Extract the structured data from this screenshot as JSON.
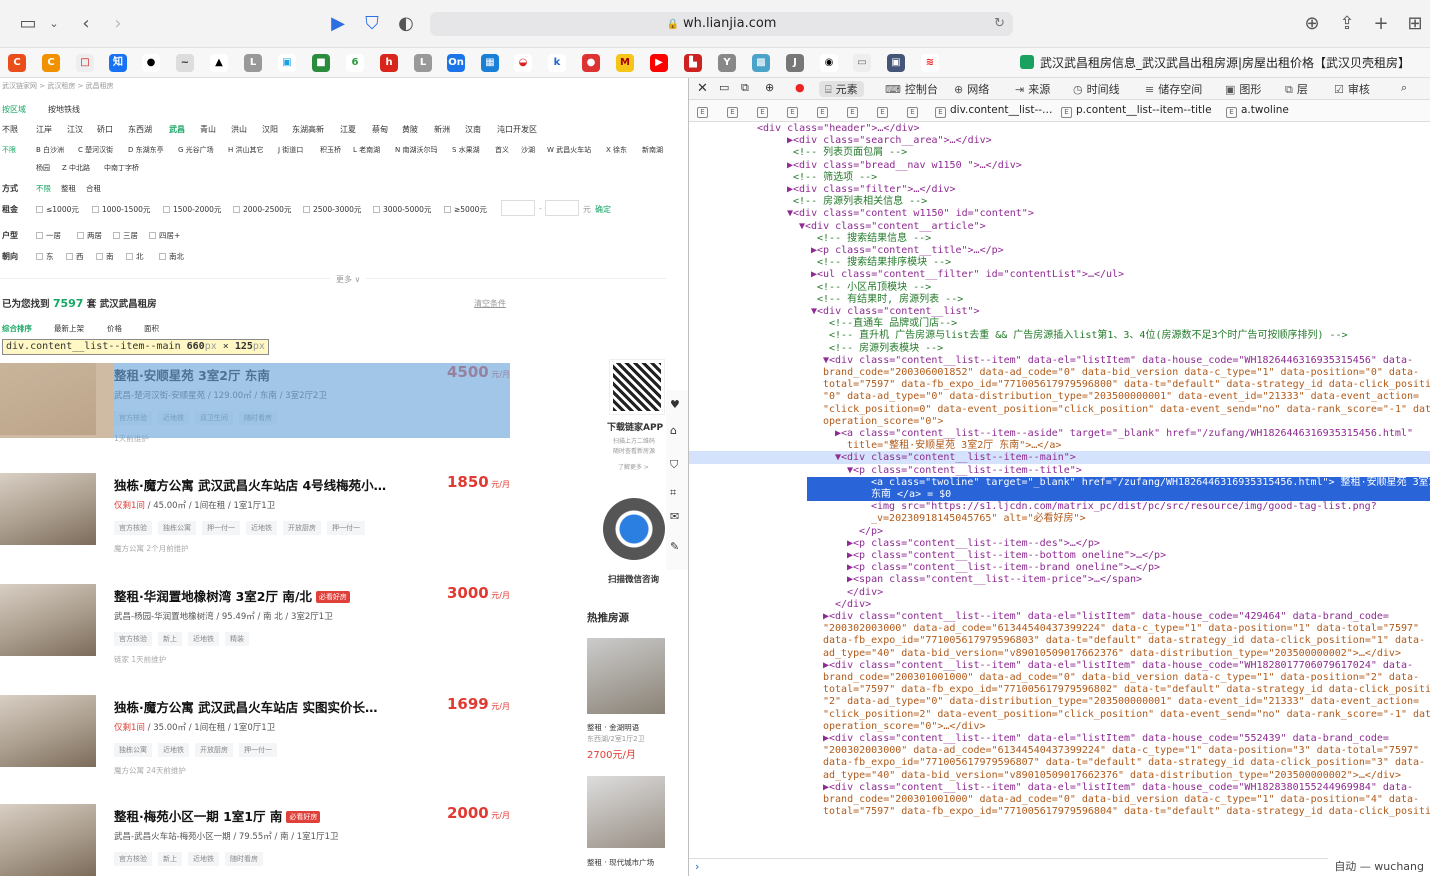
{
  "browser": {
    "url": "wh.lianjia.com"
  },
  "tab_title": "武汉武昌租房信息_武汉武昌出租房源|房屋出租价格【武汉贝壳租房】",
  "breadcrumb": "武汉链家网 > 武汉租房 > 武昌租房",
  "nav": {
    "area_label": "按区域",
    "metro_label": "按地铁线"
  },
  "districts": [
    "不限",
    "江岸",
    "江汉",
    "硚口",
    "东西湖",
    "武昌",
    "青山",
    "洪山",
    "汉阳",
    "东湖高新",
    "江夏",
    "蔡甸",
    "黄陂",
    "新洲",
    "汉南",
    "沌口开发区"
  ],
  "subareas1": [
    "不限",
    "B 白沙洲",
    "C 楚河汉街",
    "D 东湖东亭",
    "G 光谷广场",
    "H 洪山其它",
    "J 街道口",
    "积玉桥",
    "L 老南湖",
    "N 南湖沃尔玛",
    "S 水果湖",
    "首义",
    "沙湖",
    "W 武昌火车站",
    "X 徐东",
    "新南湖"
  ],
  "subareas2": [
    "杨园",
    "Z 中北路",
    "中南丁字桥"
  ],
  "mode": {
    "label": "方式",
    "options": [
      "不限",
      "整租",
      "合租"
    ]
  },
  "rent": {
    "label": "租金",
    "options": [
      "≤1000元",
      "1000-1500元",
      "1500-2000元",
      "2000-2500元",
      "2500-3000元",
      "3000-5000元",
      "≥5000元"
    ],
    "unit": "元",
    "confirm": "确定"
  },
  "layout": {
    "label": "户型",
    "options": [
      "一居",
      "两居",
      "三居",
      "四居+"
    ]
  },
  "facing": {
    "label": "朝向",
    "options": [
      "东",
      "西",
      "南",
      "北",
      "南北"
    ]
  },
  "more": "更多 ∨",
  "result": {
    "prefix": "已为您找到",
    "count": "7597",
    "suffix": "套 武汉武昌租房",
    "clear": "清空条件"
  },
  "sorts": [
    "综合排序",
    "最新上架",
    "价格",
    "面积"
  ],
  "tooltip": {
    "sel": "div.content__list--item--main",
    "w": "660",
    "h": "125",
    "unit": "px"
  },
  "listings": [
    {
      "title": "整租·安顺星苑 3室2厅 东南",
      "desc": "武昌-楚河汉街-安顺星苑 / 129.00㎡ / 东南 / 3室2厅2卫",
      "tags": [
        "官方核验",
        "近地铁",
        "双卫生间",
        "随时看房"
      ],
      "brand": "1天前维护",
      "price": "4500",
      "unit": "元/月",
      "badge": ""
    },
    {
      "title": "独栋·魔方公寓 武汉武昌火车站店 4号线梅苑小…",
      "desc_tag": "仅剩1间",
      "desc": " / 45.00㎡ / 1间在租 / 1室1厅1卫",
      "tags": [
        "官方核验",
        "独栋公寓",
        "押一付一",
        "近地铁",
        "开放厨房",
        "押一付一"
      ],
      "brand": "魔方公寓  2个月前维护",
      "price": "1850",
      "unit": "元/月",
      "badge": ""
    },
    {
      "title": "整租·华润置地橡树湾 3室2厅 南/北",
      "desc": "武昌-杨园-华润置地橡树湾 / 95.49㎡ / 南 北 / 3室2厅1卫",
      "tags": [
        "官方核验",
        "新上",
        "近地铁",
        "精装"
      ],
      "brand": "链家  1天前维护",
      "price": "3000",
      "unit": "元/月",
      "badge": "必看好房"
    },
    {
      "title": "独栋·魔方公寓 武汉武昌火车站店 实图实价长…",
      "desc_tag": "仅剩1间",
      "desc": " / 35.00㎡ / 1间在租 / 1室0厅1卫",
      "tags": [
        "独栋公寓",
        "近地铁",
        "开放厨房",
        "押一付一"
      ],
      "brand": "魔方公寓  24天前维护",
      "price": "1699",
      "unit": "元/月",
      "badge": ""
    },
    {
      "title": "整租·梅苑小区一期 1室1厅 南",
      "desc": "武昌-武昌火车站-梅苑小区一期 / 79.55㎡ / 南 / 1室1厅1卫",
      "tags": [
        "官方核验",
        "新上",
        "近地铁",
        "随时看房"
      ],
      "brand": "",
      "price": "2000",
      "unit": "元/月",
      "badge": "必看好房"
    }
  ],
  "qr": {
    "app_title": "下载链家APP",
    "app_sub1": "扫描上方二维码",
    "app_sub2": "随时查看新房源",
    "more": "了解更多 >",
    "wechat": "扫描微信咨询"
  },
  "hot": {
    "title": "热推房源",
    "item1_title": "整租 · 金湖明语",
    "item1_desc": "东西湖/2室1厅2卫",
    "item1_price": "2700元/月",
    "item2_title": "整租 · 现代城市广场"
  },
  "devtools": {
    "tabs": [
      "元素",
      "控制台",
      "网络",
      "来源",
      "时间线",
      "储存空间",
      "图形",
      "层",
      "审核"
    ],
    "crumbs": [
      "E",
      "E",
      "E",
      "E",
      "E",
      "E",
      "E",
      "E",
      "div.content__list--…",
      "p.content__list--item--title",
      "a.twoline"
    ],
    "status": "自动 — wuchang"
  },
  "code_lines": [
    {
      "t": "<div class=\"header\">…</div>",
      "cls": "tag",
      "i": 0
    },
    {
      "t": "▶<div class=\"search__area\">…</div>",
      "cls": "tag",
      "i": 5
    },
    {
      "t": " <!-- 列表页面包屑 -->",
      "cls": "cm",
      "i": 5
    },
    {
      "t": "▶<div class=\"bread__nav w1150 \">…</div>",
      "cls": "tag",
      "i": 5
    },
    {
      "t": " <!-- 筛选项 -->",
      "cls": "cm",
      "i": 5
    },
    {
      "t": "▶<div class=\"filter\">…</div>",
      "cls": "tag",
      "i": 5
    },
    {
      "t": " <!-- 房源列表相关信息 -->",
      "cls": "cm",
      "i": 5
    },
    {
      "t": "▼<div class=\"content w1150\" id=\"content\">",
      "cls": "tag",
      "i": 5
    },
    {
      "t": "▼<div class=\"content__article\">",
      "cls": "tag",
      "i": 7
    },
    {
      "t": " <!-- 搜索结果信息 -->",
      "cls": "cm",
      "i": 9
    },
    {
      "t": "▶<p class=\"content__title\">…</p>",
      "cls": "tag",
      "i": 9
    },
    {
      "t": " <!-- 搜索结果排序模块 -->",
      "cls": "cm",
      "i": 9
    },
    {
      "t": "▶<ul class=\"content__filter\" id=\"contentList\">…</ul>",
      "cls": "tag",
      "i": 9
    },
    {
      "t": " <!-- 小区吊顶模块 -->",
      "cls": "cm",
      "i": 9
    },
    {
      "t": " <!-- 有结果时, 房源列表 -->",
      "cls": "cm",
      "i": 9
    },
    {
      "t": "▼<div class=\"content__list\">",
      "cls": "tag",
      "i": 9
    },
    {
      "t": " <!--直通车 品牌或门店-->",
      "cls": "cm",
      "i": 11
    },
    {
      "t": " <!-- 直升机 广告房源与list去重 && 广告房源插入list第1、3、4位(房源数不足3个时广告可按顺序排列) -->",
      "cls": "cm",
      "i": 11
    },
    {
      "t": " <!-- 房源列表模块 -->",
      "cls": "cm",
      "i": 11
    },
    {
      "t": "▼<div class=\"content__list--item\" data-el=\"listItem\" data-house_code=\"WH1826446316935315456\" data-",
      "cls": "tag",
      "i": 11
    },
    {
      "t": "brand_code=\"200306001852\" data-ad_code=\"0\" data-bid_version data-c_type=\"1\" data-position=\"0\" data-",
      "cls": "at",
      "i": 11
    },
    {
      "t": "total=\"7597\" data-fb_expo_id=\"771005617979596800\" data-t=\"default\" data-strategy_id data-click_position=",
      "cls": "at",
      "i": 11
    },
    {
      "t": "\"0\" data-ad_type=\"0\" data-distribution_type=\"203500000001\" data-event_id=\"21333\" data-event_action=",
      "cls": "at",
      "i": 11
    },
    {
      "t": "\"click_position=0\" data-event_position=\"click_position\" data-event_send=\"no\" data-rank_score=\"-1\" data-",
      "cls": "at",
      "i": 11
    },
    {
      "t": "operation_score=\"0\">",
      "cls": "at",
      "i": 11
    },
    {
      "t": "▶<a class=\"content__list--item--aside\" target=\"_blank\" href=\"/zufang/WH1826446316935315456.html\"",
      "cls": "tag",
      "i": 13
    },
    {
      "t": "title=\"整租·安顺星苑 3室2厅 东南\">…</a>",
      "cls": "at",
      "i": 15
    },
    {
      "t": "▼<div class=\"content__list--item--main\">",
      "cls": "tag",
      "i": 13,
      "hl": true
    },
    {
      "t": "▼<p class=\"content__list--item--title\">",
      "cls": "tag",
      "i": 15
    },
    {
      "t": "<a class=\"twoline\" target=\"_blank\" href=\"/zufang/WH1826446316935315456.html\"> 整租·安顺星苑 3室2厅",
      "cls": "tag",
      "i": 19,
      "sel": true
    },
    {
      "t": "东南 </a> = $0",
      "cls": "tag",
      "i": 19,
      "sel": true
    },
    {
      "t": "<img src=\"https://s1.ljcdn.com/matrix_pc/dist/pc/src/resource/img/good-tag-list.png?",
      "cls": "tag",
      "i": 19
    },
    {
      "t": "_v=20230918145045765\" alt=\"必看好房\">",
      "cls": "at",
      "i": 19
    },
    {
      "t": "</p>",
      "cls": "tag",
      "i": 17
    },
    {
      "t": "▶<p class=\"content__list--item--des\">…</p>",
      "cls": "tag",
      "i": 15
    },
    {
      "t": "▶<p class=\"content__list--item--bottom oneline\">…</p>",
      "cls": "tag",
      "i": 15
    },
    {
      "t": "▶<p class=\"content__list--item--brand oneline\">…</p>",
      "cls": "tag",
      "i": 15
    },
    {
      "t": "▶<span class=\"content__list--item-price\">…</span>",
      "cls": "tag",
      "i": 15
    },
    {
      "t": "</div>",
      "cls": "tag",
      "i": 15
    },
    {
      "t": "</div>",
      "cls": "tag",
      "i": 13
    },
    {
      "t": "▶<div class=\"content__list--item\" data-el=\"listItem\" data-house_code=\"429464\" data-brand_code=",
      "cls": "tag",
      "i": 11
    },
    {
      "t": "\"200302003000\" data-ad_code=\"61344540437399224\" data-c_type=\"1\" data-position=\"1\" data-total=\"7597\"",
      "cls": "at",
      "i": 11
    },
    {
      "t": "data-fb_expo_id=\"771005617979596803\" data-t=\"default\" data-strategy_id data-click_position=\"1\" data-",
      "cls": "at",
      "i": 11
    },
    {
      "t": "ad_type=\"40\" data-bid_version=\"v89010509017662376\" data-distribution_type=\"203500000002\">…</div>",
      "cls": "at",
      "i": 11
    },
    {
      "t": "▶<div class=\"content__list--item\" data-el=\"listItem\" data-house_code=\"WH1828017706079617024\" data-",
      "cls": "tag",
      "i": 11
    },
    {
      "t": "brand_code=\"200301001000\" data-ad_code=\"0\" data-bid_version data-c_type=\"1\" data-position=\"2\" data-",
      "cls": "at",
      "i": 11
    },
    {
      "t": "total=\"7597\" data-fb_expo_id=\"771005617979596802\" data-t=\"default\" data-strategy_id data-click_position=",
      "cls": "at",
      "i": 11
    },
    {
      "t": "\"2\" data-ad_type=\"0\" data-distribution_type=\"203500000001\" data-event_id=\"21333\" data-event_action=",
      "cls": "at",
      "i": 11
    },
    {
      "t": "\"click_position=2\" data-event_position=\"click_position\" data-event_send=\"no\" data-rank_score=\"-1\" data-",
      "cls": "at",
      "i": 11
    },
    {
      "t": "operation_score=\"0\">…</div>",
      "cls": "at",
      "i": 11
    },
    {
      "t": "▶<div class=\"content__list--item\" data-el=\"listItem\" data-house_code=\"552439\" data-brand_code=",
      "cls": "tag",
      "i": 11
    },
    {
      "t": "\"200302003000\" data-ad_code=\"61344540437399224\" data-c_type=\"1\" data-position=\"3\" data-total=\"7597\"",
      "cls": "at",
      "i": 11
    },
    {
      "t": "data-fb_expo_id=\"771005617979596807\" data-t=\"default\" data-strategy_id data-click_position=\"3\" data-",
      "cls": "at",
      "i": 11
    },
    {
      "t": "ad_type=\"40\" data-bid_version=\"v89010509017662376\" data-distribution_type=\"203500000002\">…</div>",
      "cls": "at",
      "i": 11
    },
    {
      "t": "▶<div class=\"content__list--item\" data-el=\"listItem\" data-house_code=\"WH1828380155244969984\" data-",
      "cls": "tag",
      "i": 11
    },
    {
      "t": "brand_code=\"200301001000\" data-ad_code=\"0\" data-bid_version data-c_type=\"1\" data-position=\"4\" data-",
      "cls": "at",
      "i": 11
    },
    {
      "t": "total=\"7597\" data-fb_expo_id=\"771005617979596804\" data-t=\"default\" data-strategy_id data-click_position",
      "cls": "at",
      "i": 11
    }
  ]
}
